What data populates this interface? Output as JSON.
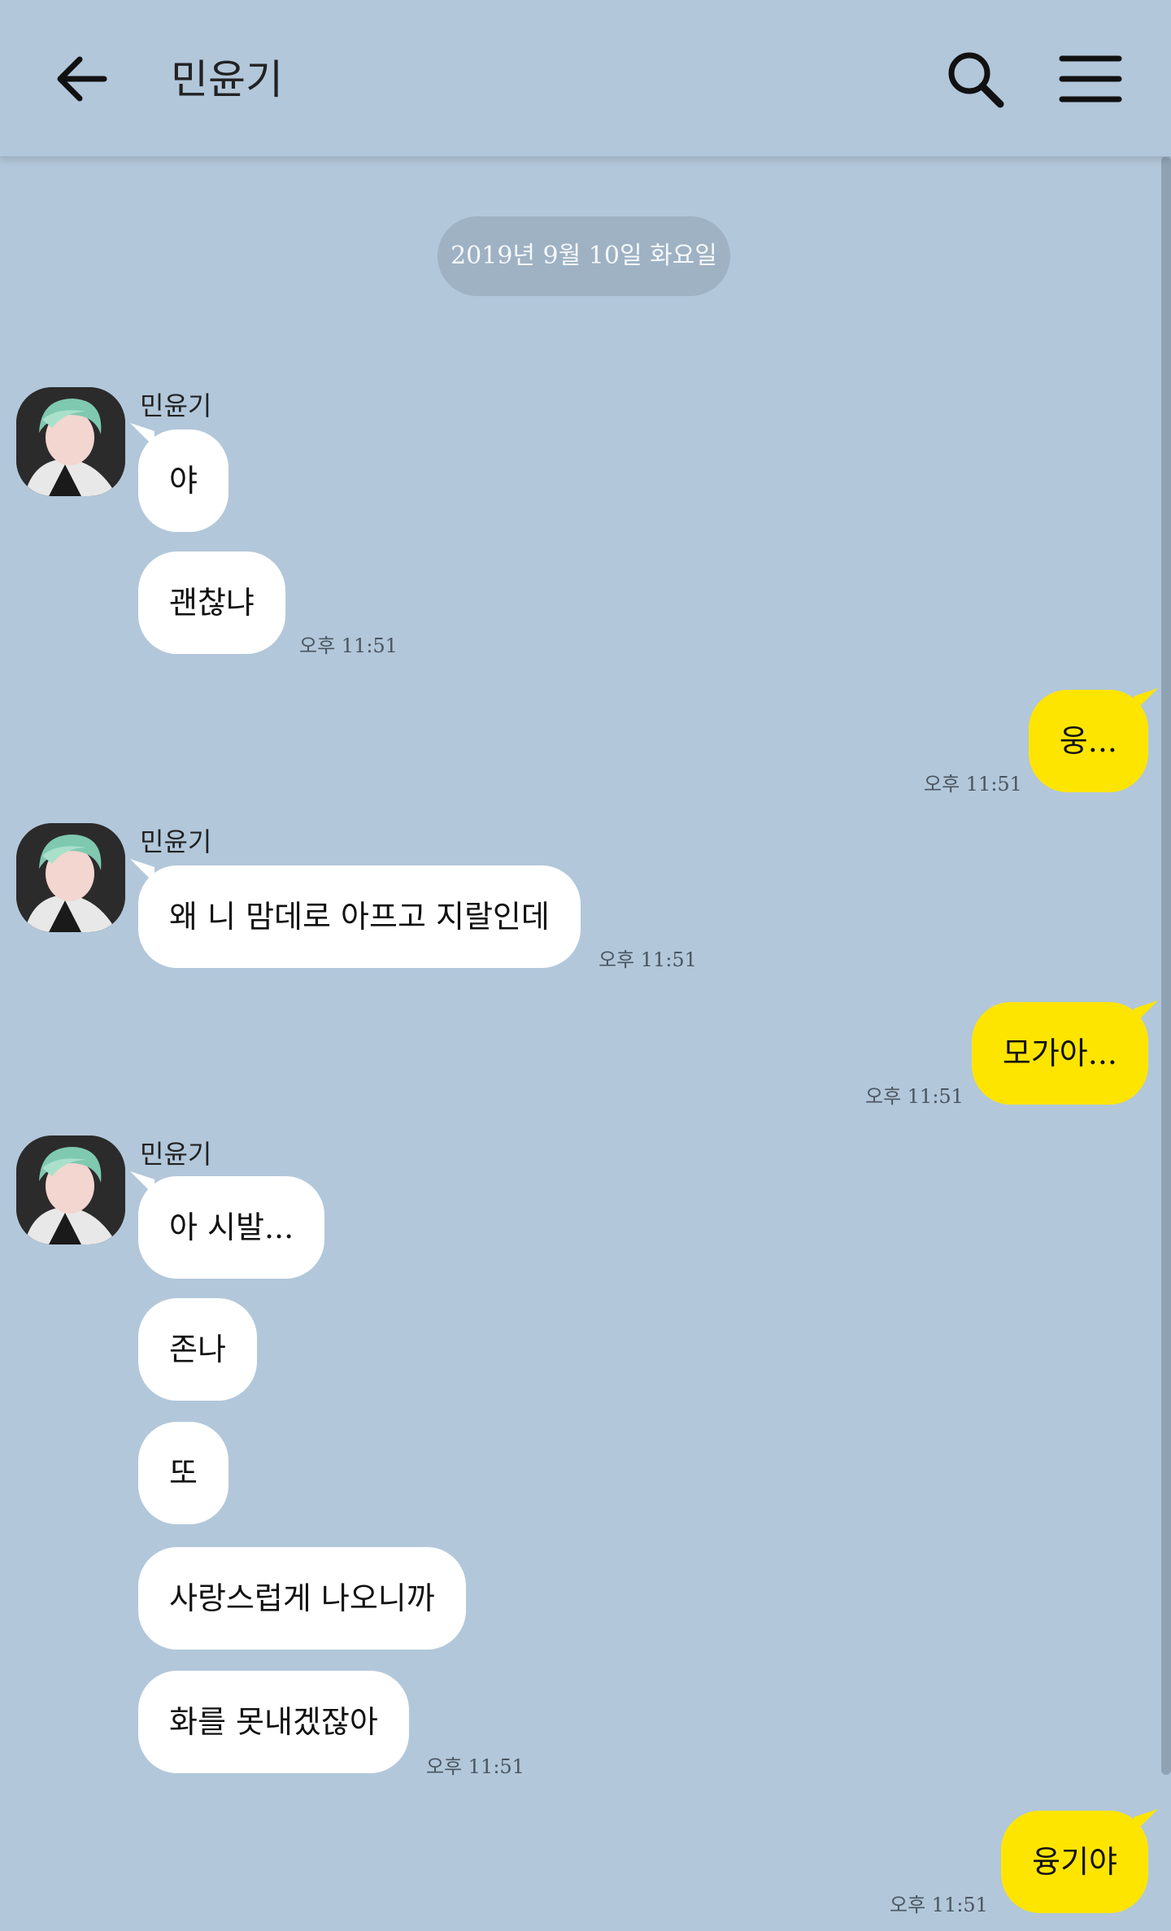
{
  "header": {
    "title": "민윤기",
    "back_icon": "arrow-left-icon",
    "search_icon": "search-icon",
    "menu_icon": "hamburger-menu-icon"
  },
  "date_divider": "2019년 9월 10일 화요일",
  "colors": {
    "background": "#b2c7da",
    "incoming_bubble": "#ffffff",
    "outgoing_bubble": "#fee500"
  },
  "messages": {
    "g1": {
      "sender": "민윤기",
      "m1": "야",
      "m2": "괜찮냐",
      "time": "오후 11:51"
    },
    "o1": {
      "text": "웅...",
      "time": "오후 11:51"
    },
    "g2": {
      "sender": "민윤기",
      "m1": "왜 니 맘데로 아프고 지랄인데",
      "time": "오후 11:51"
    },
    "o2": {
      "text": "모가아...",
      "time": "오후 11:51"
    },
    "g3": {
      "sender": "민윤기",
      "m1": "아 시발...",
      "m2": "존나",
      "m3": "또",
      "m4": "사랑스럽게 나오니까",
      "m5": "화를 못내겠잖아",
      "time": "오후 11:51"
    },
    "o3": {
      "text": "융기야",
      "time": "오후 11:51"
    }
  }
}
